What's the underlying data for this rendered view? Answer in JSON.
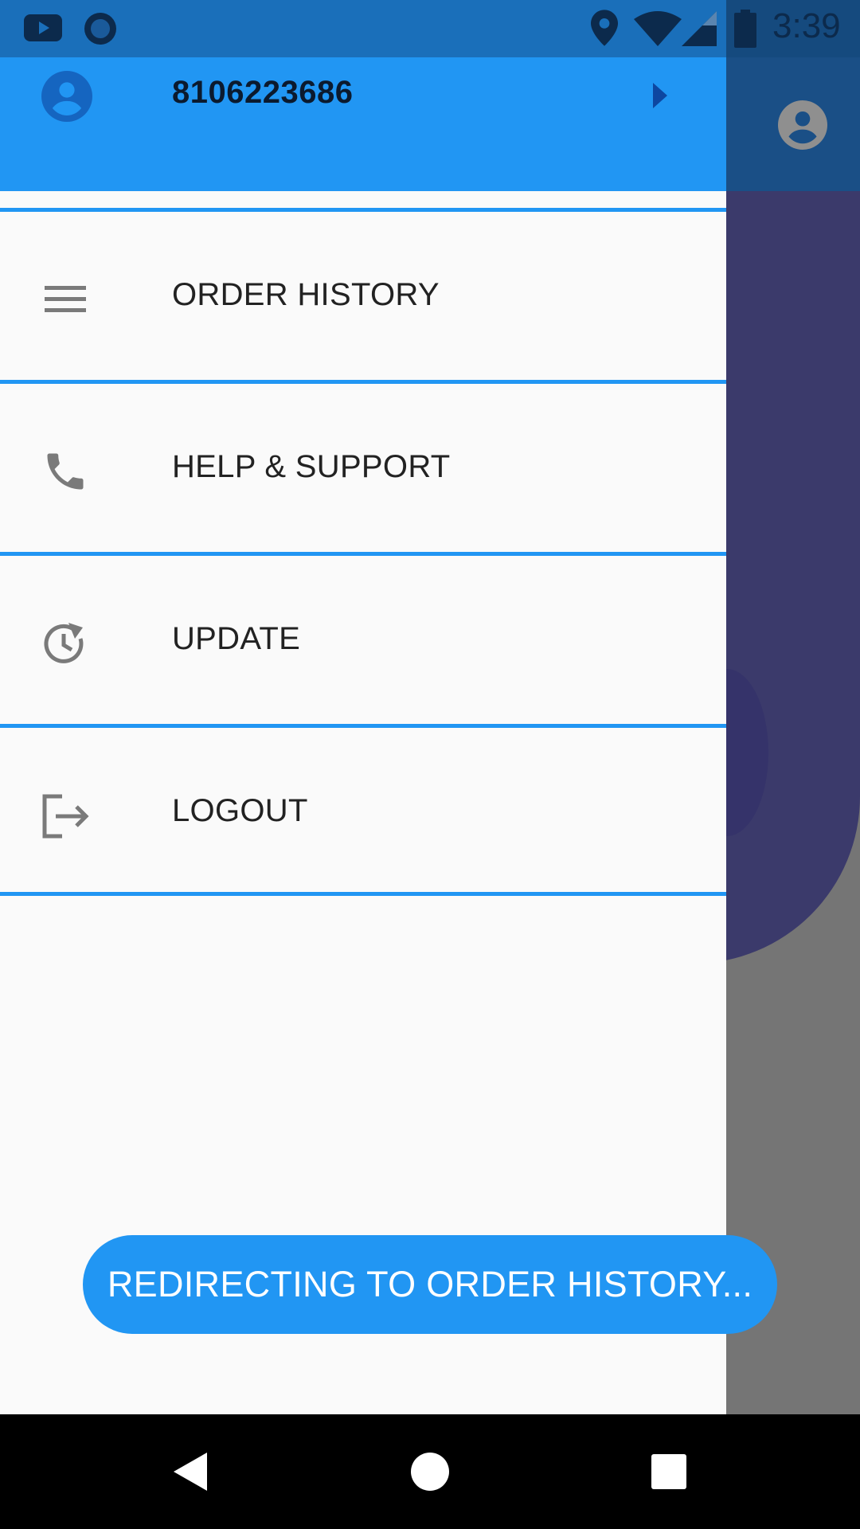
{
  "status_bar": {
    "time": "3:39",
    "icons": [
      "youtube-icon",
      "circle-notification-icon",
      "location-icon",
      "wifi-icon",
      "signal-icon",
      "battery-icon"
    ]
  },
  "drawer": {
    "header": {
      "phone": "8106223686",
      "avatar_icon": "account-circle-icon",
      "arrow_icon": "arrow-right-icon"
    },
    "items": [
      {
        "label": "ORDER HISTORY",
        "icon": "menu-lines-icon"
      },
      {
        "label": "HELP & SUPPORT",
        "icon": "phone-icon"
      },
      {
        "label": "UPDATE",
        "icon": "update-icon"
      },
      {
        "label": "LOGOUT",
        "icon": "logout-icon"
      }
    ]
  },
  "toast": {
    "message": "REDIRECTING TO ORDER HISTORY..."
  },
  "nav_bar": {
    "buttons": [
      "back-icon",
      "home-icon",
      "recents-icon"
    ]
  },
  "colors": {
    "accent": "#2196f3",
    "status_bar": "#1a6fba",
    "drawer_bg": "#fafafa",
    "icon_grey": "#757575",
    "text": "#222222"
  }
}
